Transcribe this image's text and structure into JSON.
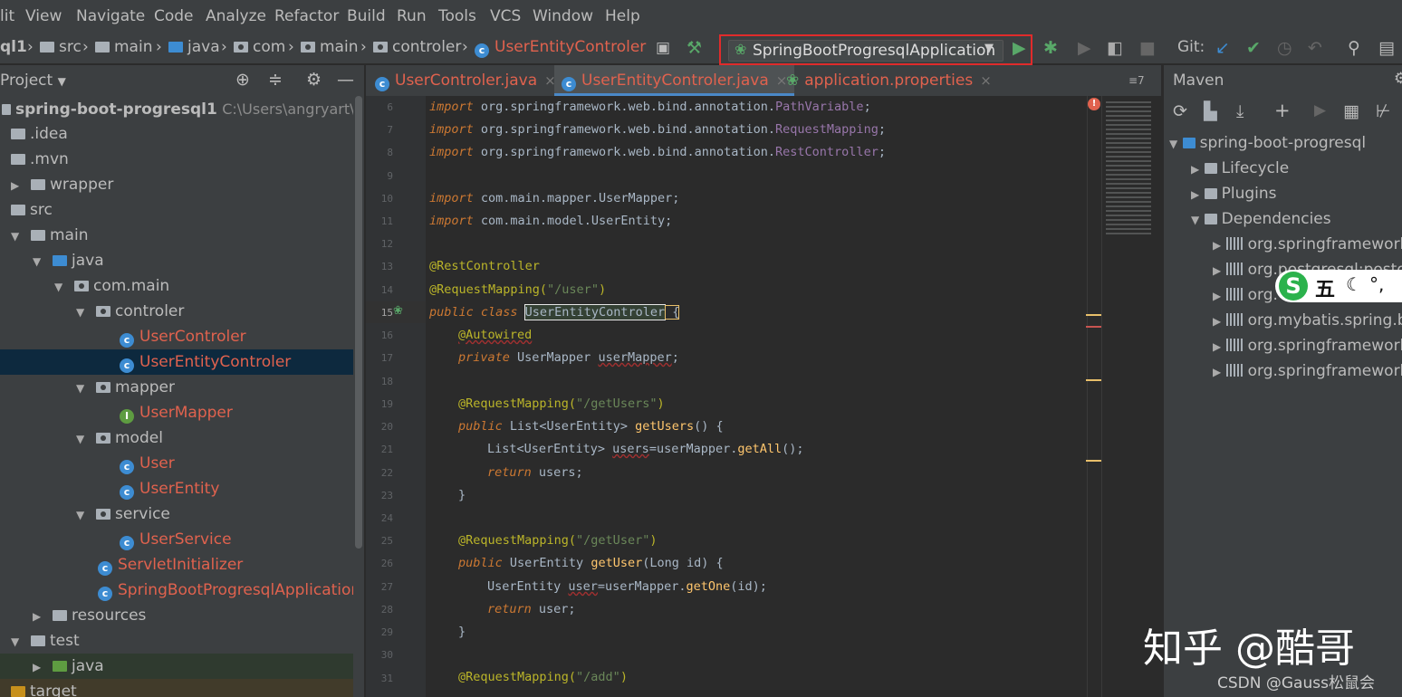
{
  "menu": [
    "lit",
    "View",
    "Navigate",
    "Code",
    "Analyze",
    "Refactor",
    "Build",
    "Run",
    "Tools",
    "VCS",
    "Window",
    "Help"
  ],
  "breadcrumbs": [
    "ql1",
    "src",
    "main",
    "java",
    "com",
    "main",
    "controler",
    "UserEntityControler"
  ],
  "run_config": "SpringBootProgresqlApplication",
  "git_label": "Git:",
  "project_panel": {
    "title": "Project",
    "tree": [
      {
        "label": "spring-boot-progresql1",
        "extra": "C:\\Users\\angryart\\Deskto"
      },
      {
        "label": ".idea"
      },
      {
        "label": ".mvn"
      },
      {
        "label": "wrapper"
      },
      {
        "label": "src"
      },
      {
        "label": "main"
      },
      {
        "label": "java"
      },
      {
        "label": "com.main"
      },
      {
        "label": "controler"
      },
      {
        "label": "UserControler"
      },
      {
        "label": "UserEntityControler"
      },
      {
        "label": "mapper"
      },
      {
        "label": "UserMapper"
      },
      {
        "label": "model"
      },
      {
        "label": "User"
      },
      {
        "label": "UserEntity"
      },
      {
        "label": "service"
      },
      {
        "label": "UserService"
      },
      {
        "label": "ServletInitializer"
      },
      {
        "label": "SpringBootProgresqlApplication"
      },
      {
        "label": "resources"
      },
      {
        "label": "test"
      },
      {
        "label": "java"
      },
      {
        "label": "target"
      }
    ]
  },
  "editor": {
    "tabs": [
      "UserControler.java",
      "UserEntityControler.java",
      "application.properties"
    ],
    "tab_menu": "≡7",
    "line_numbers": [
      "6",
      "7",
      "8",
      "9",
      "10",
      "11",
      "12",
      "13",
      "14",
      "15",
      "16",
      "17",
      "18",
      "19",
      "20",
      "21",
      "22",
      "23",
      "24",
      "25",
      "26",
      "27",
      "28",
      "29",
      "30",
      "31"
    ],
    "code": {
      "l6a": "import",
      "l6b": " org.springframework.web.bind.annotation.",
      "l6c": "PathVariable",
      "l6d": ";",
      "l7a": "import",
      "l7b": " org.springframework.web.bind.annotation.",
      "l7c": "RequestMapping",
      "l7d": ";",
      "l8a": "import",
      "l8b": " org.springframework.web.bind.annotation.",
      "l8c": "RestController",
      "l8d": ";",
      "l10a": "import",
      "l10b": " com.main.mapper.UserMapper;",
      "l11a": "import",
      "l11b": " com.main.model.UserEntity;",
      "l13": "@RestController",
      "l14a": "@RequestMapping(",
      "l14b": "\"/user\"",
      "l14c": ")",
      "l15a": "public class ",
      "l15b": "UserEntityControler",
      "l15c": " {",
      "l16": "@Autowired",
      "l17a": "private ",
      "l17b": "UserMapper ",
      "l17c": "userMapper",
      ";": ";",
      "l19a": "@RequestMapping(",
      "l19b": "\"/getUsers\"",
      "l19c": ")",
      "l20a": "public ",
      "l20b": "List<UserEntity> ",
      "l20c": "getUsers",
      "l20d": "() {",
      "l21a": "List<UserEntity> ",
      "l21b": "users",
      "l21c": "=userMapper.",
      "l21d": "getAll",
      "l21e": "();",
      "l22a": "return ",
      "l22b": "users;",
      "l23": "}",
      "l25a": "@RequestMapping(",
      "l25b": "\"/getUser\"",
      "l25c": ")",
      "l26a": "public ",
      "l26b": "UserEntity ",
      "l26c": "getUser",
      "l26d": "(Long id) {",
      "l27a": "UserEntity ",
      "l27b": "user",
      "l27c": "=userMapper.",
      "l27d": "getOne",
      "l27e": "(id);",
      "l28a": "return ",
      "l28b": "user;",
      "l29": "}",
      "l31a": "@RequestMapping(",
      "l31b": "\"/add\"",
      "l31c": ")"
    }
  },
  "maven": {
    "title": "Maven",
    "tree": [
      {
        "label": "spring-boot-progresql"
      },
      {
        "label": "Lifecycle"
      },
      {
        "label": "Plugins"
      },
      {
        "label": "Dependencies"
      },
      {
        "label": "org.springframework."
      },
      {
        "label": "org.postgresql:postgr"
      },
      {
        "label": "org."
      },
      {
        "label": "org.mybatis.spring.bo"
      },
      {
        "label": "org.springframework."
      },
      {
        "label": "org.springframework."
      }
    ]
  },
  "ime_text": "五",
  "watermark": "知乎 @酷哥",
  "csdn_credit": "CSDN @Gauss松鼠会",
  "colors": {
    "accent": "#4a88c7",
    "highlight_box": "#e02b2b",
    "run_green": "#59a869",
    "error_red": "#e0624e"
  }
}
